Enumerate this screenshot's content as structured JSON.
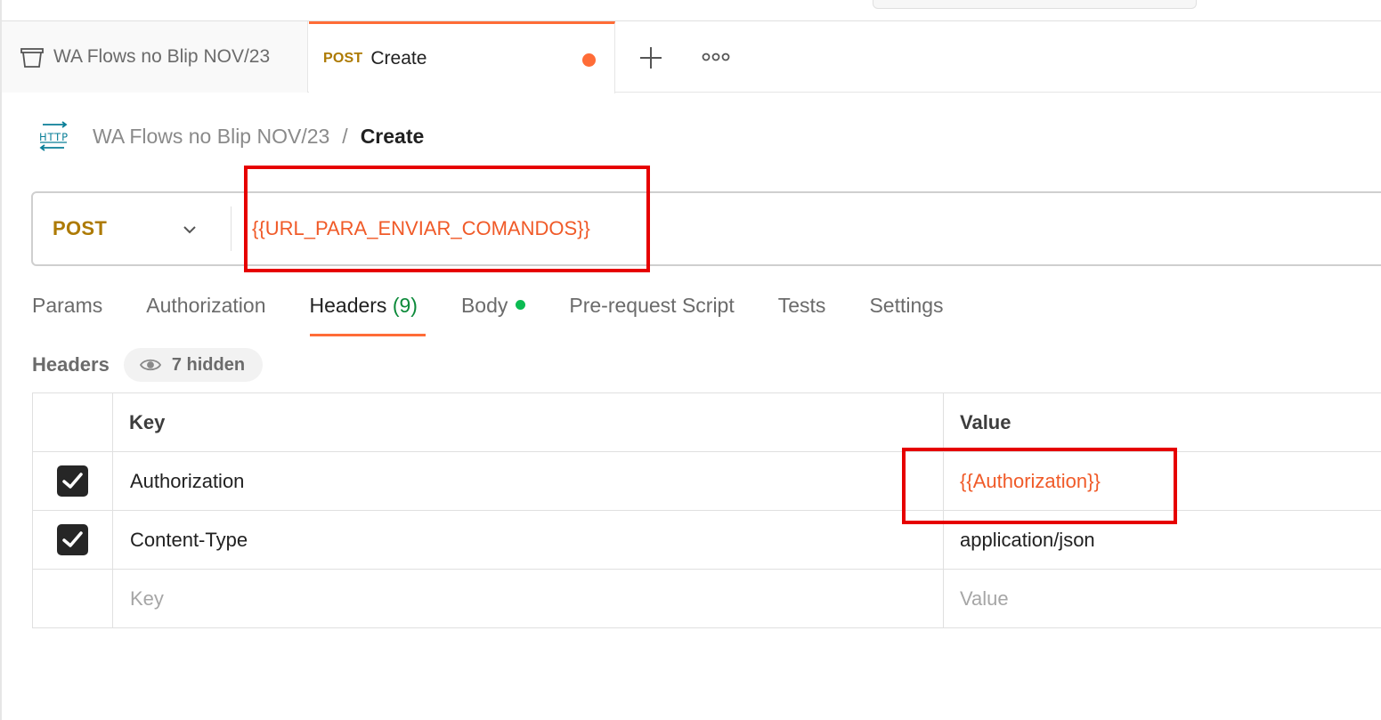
{
  "tabs": {
    "collection": {
      "title": "WA Flows no Blip NOV/23",
      "icon": "collection-icon"
    },
    "active": {
      "method": "POST",
      "title": "Create",
      "unsaved": true
    },
    "new_tab_icon": "plus-icon",
    "more_icon": "more-icon"
  },
  "breadcrumb": {
    "icon": "http-request-icon",
    "parent": "WA Flows no Blip NOV/23",
    "separator": "/",
    "current": "Create"
  },
  "request": {
    "method": "POST",
    "url": "{{URL_PARA_ENVIAR_COMANDOS}}"
  },
  "request_tabs": [
    {
      "label": "Params"
    },
    {
      "label": "Authorization"
    },
    {
      "label": "Headers",
      "count": "(9)",
      "active": true
    },
    {
      "label": "Body",
      "has_content": true
    },
    {
      "label": "Pre-request Script"
    },
    {
      "label": "Tests"
    },
    {
      "label": "Settings"
    }
  ],
  "headers_section": {
    "title": "Headers",
    "hidden_label": "7 hidden"
  },
  "headers_table": {
    "columns": {
      "key": "Key",
      "value": "Value"
    },
    "rows": [
      {
        "checked": true,
        "key": "Authorization",
        "value": "{{Authorization}}",
        "value_is_variable": true
      },
      {
        "checked": true,
        "key": "Content-Type",
        "value": "application/json",
        "value_is_variable": false
      }
    ],
    "new_row": {
      "key_placeholder": "Key",
      "value_placeholder": "Value"
    }
  },
  "colors": {
    "accent": "#ff6c37",
    "method_post": "#ad7a03",
    "variable": "#f05a28",
    "highlight_annotation": "#e60000",
    "body_dot": "#0cbb52"
  }
}
